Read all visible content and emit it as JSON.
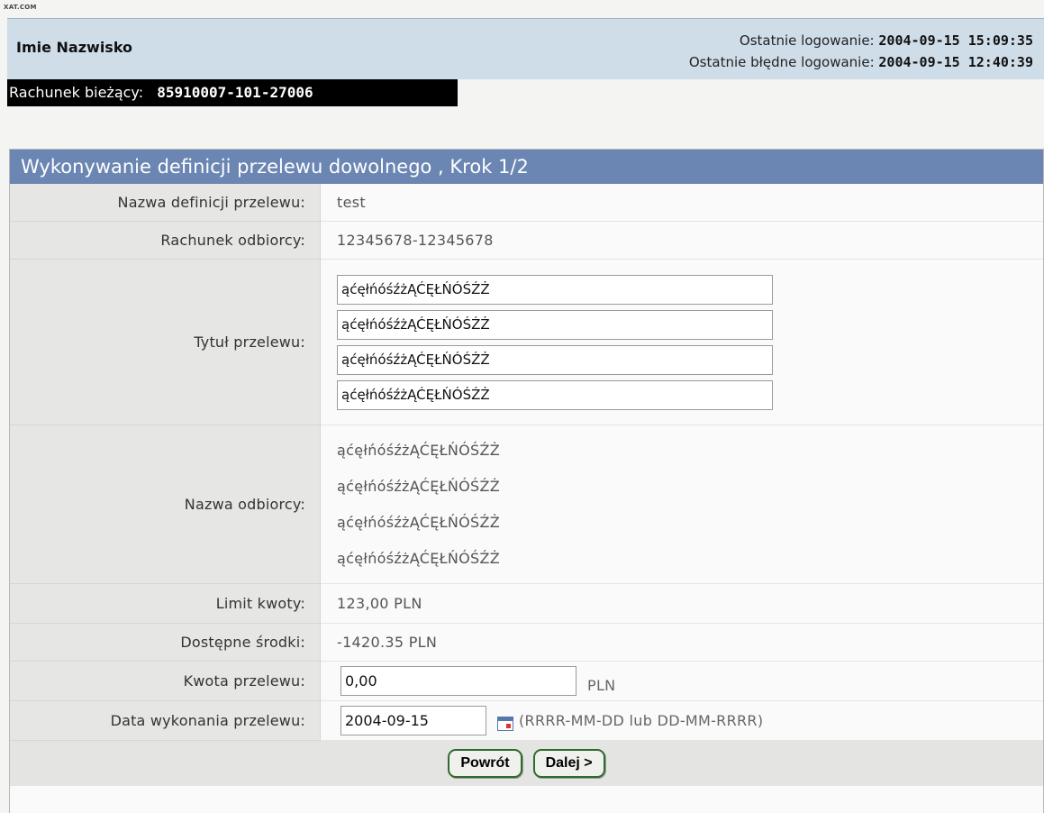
{
  "watermark": "XAT.COM",
  "header": {
    "user_name": "Imie Nazwisko",
    "last_login_label": "Ostatnie logowanie:",
    "last_login_value": "2004-09-15 15:09:35",
    "last_failed_login_label": "Ostatnie błędne logowanie:",
    "last_failed_login_value": "2004-09-15 12:40:39"
  },
  "account": {
    "label": "Rachunek bieżący:",
    "number": "85910007-101-27006"
  },
  "form": {
    "title": "Wykonywanie definicji przelewu dowolnego , Krok 1/2",
    "definition_name_label": "Nazwa definicji przelewu:",
    "definition_name_value": "test",
    "recipient_account_label": "Rachunek odbiorcy:",
    "recipient_account_value": "12345678-12345678",
    "title_label": "Tytuł przelewu:",
    "title_lines": [
      "ąćęłńóśźżĄĆĘŁŃÓŚŹŻ",
      "ąćęłńóśźżĄĆĘŁŃÓŚŹŻ",
      "ąćęłńóśźżĄĆĘŁŃÓŚŹŻ",
      "ąćęłńóśźżĄĆĘŁŃÓŚŹŻ"
    ],
    "recipient_name_label": "Nazwa odbiorcy:",
    "recipient_name_lines": [
      "ąćęłńóśźżĄĆĘŁŃÓŚŹŻ",
      "ąćęłńóśźżĄĆĘŁŃÓŚŹŻ",
      "ąćęłńóśźżĄĆĘŁŃÓŚŹŻ",
      "ąćęłńóśźżĄĆĘŁŃÓŚŹŻ"
    ],
    "limit_label": "Limit kwoty:",
    "limit_value": "123,00 PLN",
    "available_label": "Dostępne środki:",
    "available_value": "-1420.35 PLN",
    "amount_label": "Kwota przelewu:",
    "amount_value": "0,00",
    "amount_currency": "PLN",
    "date_label": "Data wykonania przelewu:",
    "date_value": "2004-09-15",
    "date_format_hint": "(RRRR-MM-DD lub DD-MM-RRRR)",
    "calendar_icon": "calendar-icon"
  },
  "buttons": {
    "back": "Powrót",
    "next": "Dalej >"
  }
}
